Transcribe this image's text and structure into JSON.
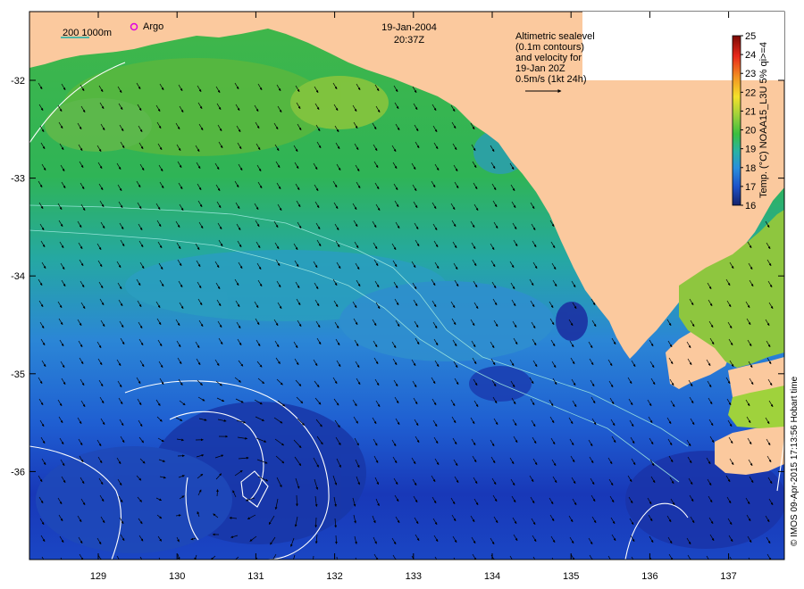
{
  "map": {
    "title_date": "19-Jan-2004",
    "title_time": "20:37Z",
    "scale_label": "200  1000m",
    "argo_label": "Argo",
    "annotation_lines": [
      "Altimetric sealevel",
      "(0.1m contours)",
      "and velocity for",
      "19-Jan 20Z",
      "0.5m/s (1kt 24h)"
    ],
    "credit": "© IMOS 09-Apr-2015 17:13:56 Hobart time",
    "lon_ticks": [
      "129",
      "130",
      "131",
      "132",
      "133",
      "134",
      "135",
      "136",
      "137"
    ],
    "lat_ticks": [
      "-32",
      "-33",
      "-34",
      "-35",
      "-36"
    ],
    "colorbar": {
      "title": "Temp. (°C) NOAA15_L3U 5% qi>=4",
      "ticks": [
        "25",
        "24",
        "23",
        "22",
        "21",
        "20",
        "19",
        "18",
        "17",
        "16"
      ],
      "range": [
        16,
        25
      ]
    },
    "colors": {
      "land": "#fbc99e",
      "contour": "#ffffff",
      "argo": "#e000e0"
    }
  }
}
